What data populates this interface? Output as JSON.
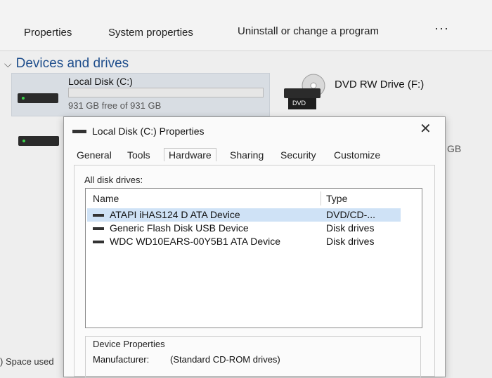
{
  "toolbar": {
    "properties": "Properties",
    "system_properties": "System properties",
    "uninstall": "Uninstall or change a program",
    "more": "···"
  },
  "section": {
    "title": "Devices and drives",
    "chevron": "⌵"
  },
  "drives": {
    "c": {
      "name": "Local Disk (C:)",
      "free": "931 GB free of 931 GB",
      "used_fraction": 0.0
    },
    "dvd": {
      "name": "DVD RW Drive (F:)",
      "badge": "DVD"
    },
    "partial_size": "GB"
  },
  "status": {
    "text": ") Space used"
  },
  "dialog": {
    "title": "Local Disk (C:) Properties",
    "close": "✕",
    "tabs": [
      "General",
      "Tools",
      "Hardware",
      "Sharing",
      "Security",
      "Customize"
    ],
    "active_tab": "Hardware",
    "all_disk_drives_label": "All disk drives:",
    "columns": {
      "name": "Name",
      "type": "Type"
    },
    "rows": [
      {
        "name": "ATAPI iHAS124   D ATA Device",
        "type": "DVD/CD-...",
        "selected": true
      },
      {
        "name": "Generic Flash Disk USB Device",
        "type": "Disk drives",
        "selected": false
      },
      {
        "name": "WDC WD10EARS-00Y5B1 ATA Device",
        "type": "Disk drives",
        "selected": false
      }
    ],
    "device_properties": {
      "title": "Device Properties",
      "manufacturer_label": "Manufacturer:",
      "manufacturer_value": "(Standard CD-ROM drives)"
    }
  },
  "colors": {
    "accent_link": "#1f4e8c",
    "selection": "#cfe2f6",
    "drive_free_led": "#3ad14a"
  }
}
